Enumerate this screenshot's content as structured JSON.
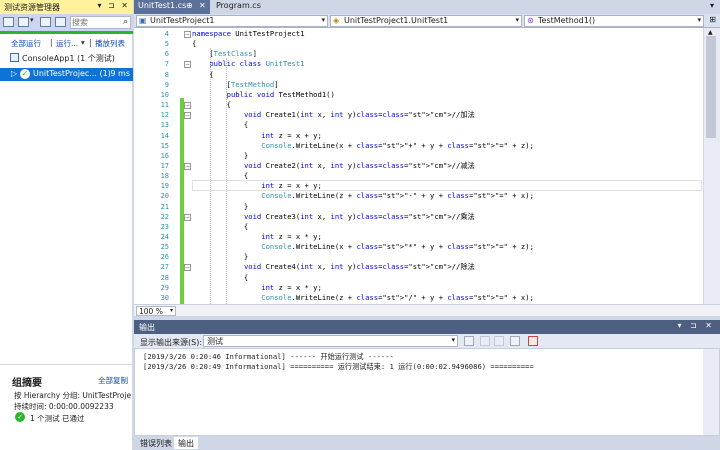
{
  "left_panel": {
    "title": "测试资源管理器",
    "title_buttons": "▾ ⊐ ✕",
    "search_placeholder": "搜索",
    "run_all": "全部运行",
    "run_menu": "运行...",
    "playlist": "播放列表",
    "tree": {
      "app": "ConsoleApp1 (1 个测试)",
      "project": "UnitTestProjec... (1)",
      "project_time": "9 ms"
    },
    "summary": {
      "title": "组摘要",
      "copy_all": "全部复制",
      "hierarchy": "按 Hierarchy 分组: UnitTestProje",
      "duration": "持续时间: 0:00:00.0092233",
      "passed": "1 个测试 已通过"
    }
  },
  "editor": {
    "tabs": [
      {
        "label": "UnitTest1.cs",
        "pin": "⊕",
        "close": "✕"
      },
      {
        "label": "Program.cs"
      }
    ],
    "nav": {
      "project": "UnitTestProject1",
      "class": "UnitTestProject1.UnitTest1",
      "member": "TestMethod1()"
    },
    "zoom": "100 %",
    "lines": [
      {
        "n": "4",
        "text": "namespace UnitTestProject1"
      },
      {
        "n": "5",
        "text": "{"
      },
      {
        "n": "6",
        "text": "    [TestClass]"
      },
      {
        "n": "7",
        "text": "    public class UnitTest1"
      },
      {
        "n": "8",
        "text": "    {"
      },
      {
        "n": "9",
        "text": "        [TestMethod]"
      },
      {
        "n": "10",
        "text": "        public void TestMethod1()"
      },
      {
        "n": "11",
        "text": "        {"
      },
      {
        "n": "12",
        "text": "            void Create1(int x, int y)//加法"
      },
      {
        "n": "13",
        "text": "            {"
      },
      {
        "n": "14",
        "text": "                int z = x + y;"
      },
      {
        "n": "15",
        "text": "                Console.WriteLine(x + \"+\" + y + \"=\" + z);"
      },
      {
        "n": "16",
        "text": "            }"
      },
      {
        "n": "17",
        "text": "            void Create2(int x, int y)//减法"
      },
      {
        "n": "18",
        "text": "            {"
      },
      {
        "n": "19",
        "text": "                int z = x + y;"
      },
      {
        "n": "20",
        "text": "                Console.WriteLine(z + \"-\" + y + \"=\" + x);"
      },
      {
        "n": "21",
        "text": "            }"
      },
      {
        "n": "22",
        "text": "            void Create3(int x, int y)//乘法"
      },
      {
        "n": "23",
        "text": "            {"
      },
      {
        "n": "24",
        "text": "                int z = x * y;"
      },
      {
        "n": "25",
        "text": "                Console.WriteLine(x + \"*\" + y + \"=\" + z);"
      },
      {
        "n": "26",
        "text": "            }"
      },
      {
        "n": "27",
        "text": "            void Create4(int x, int y)//除法"
      },
      {
        "n": "28",
        "text": "            {"
      },
      {
        "n": "29",
        "text": "                int z = x * y;"
      },
      {
        "n": "30",
        "text": "                Console.WriteLine(z + \"/\" + y + \"=\" + x);"
      },
      {
        "n": "31",
        "text": "            }"
      }
    ]
  },
  "output": {
    "title": "输出",
    "title_buttons": "▾ ⊐ ✕",
    "source_label": "显示输出来源(S):",
    "source_value": "测试",
    "lines": [
      "[2019/3/26 0:20:46 Informational] ------ 开始运行测试 ------",
      "[2019/3/26 0:20:49 Informational] ========== 运行测试结束: 1 运行(0:00:02.9496086) =========="
    ],
    "bottom_tabs": [
      "错误列表",
      "输出"
    ]
  },
  "colors": {
    "accent": "#0e73d6",
    "title_yellow": "#fff29d",
    "pass_green": "#2bb52b",
    "tab_active": "#5b7199"
  }
}
